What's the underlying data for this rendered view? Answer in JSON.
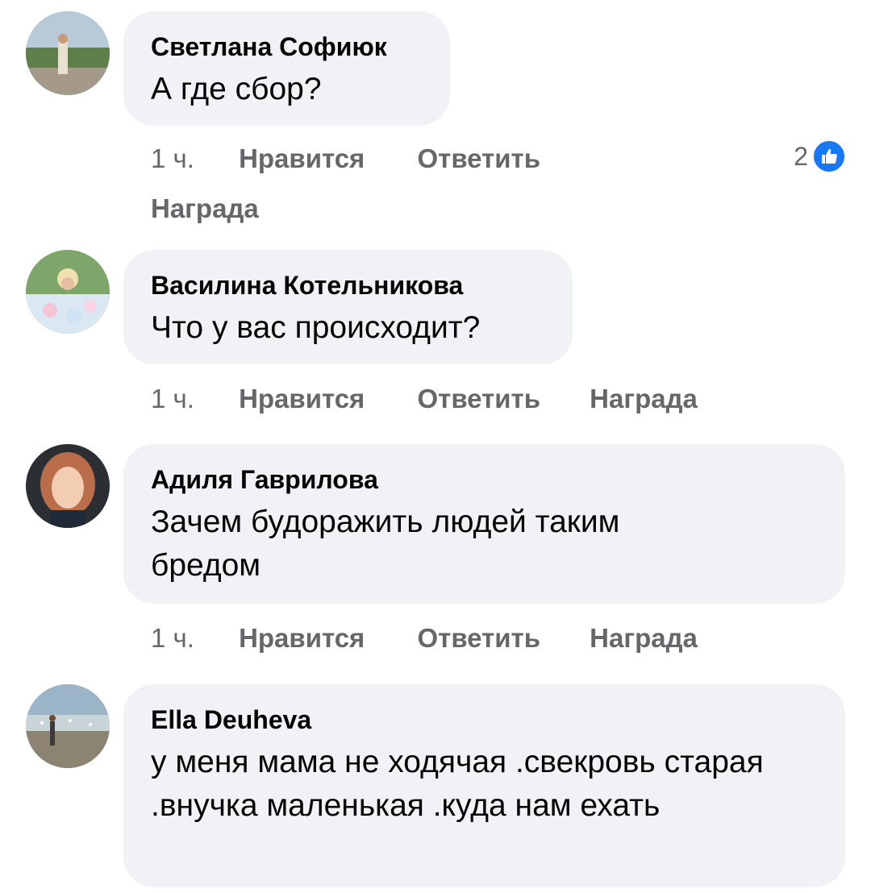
{
  "comments": [
    {
      "author": "Светлана Софиюк",
      "text": "А где сбор?",
      "time": "1 ч.",
      "like_label": "Нравится",
      "reply_label": "Ответить",
      "award_label": "Награда",
      "reaction_count": "2"
    },
    {
      "author": "Василина Котельникова",
      "text": "Что у вас происходит?",
      "time": "1 ч.",
      "like_label": "Нравится",
      "reply_label": "Ответить",
      "award_label": "Награда"
    },
    {
      "author": "Адиля Гаврилова",
      "text": "Зачем будоражить людей таким бредом",
      "time": "1 ч.",
      "like_label": "Нравится",
      "reply_label": "Ответить",
      "award_label": "Награда"
    },
    {
      "author": "Ella Deuheva",
      "text": "у меня мама не ходячая .свекровь старая .внучка маленькая .куда нам ехать"
    }
  ],
  "colors": {
    "bubble": "#f0f2f5",
    "meta_text": "#65676b",
    "like_blue": "#1877f2"
  }
}
